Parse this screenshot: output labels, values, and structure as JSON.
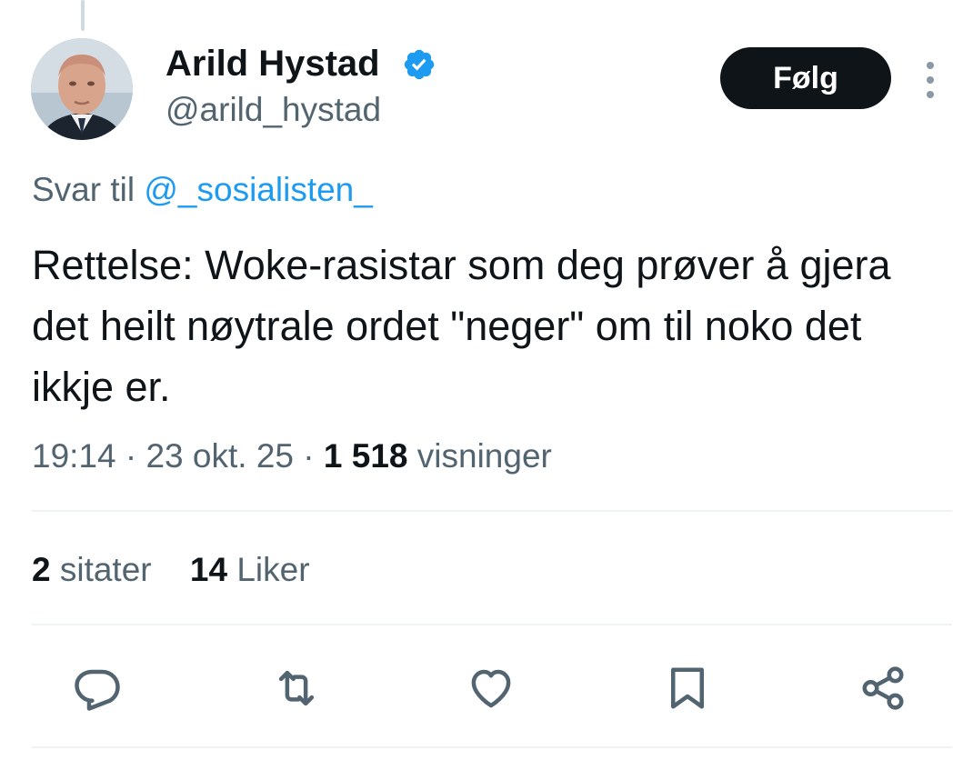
{
  "author": {
    "display_name": "Arild Hystad",
    "handle": "@arild_hystad",
    "verified": true,
    "verified_color": "#1d9bf0"
  },
  "follow_label": "Følg",
  "reply": {
    "prefix": "Svar til",
    "mention": "@_sosialisten_"
  },
  "tweet": {
    "text": "Rettelse: Woke-rasistar som deg prøver å gjera det heilt nøytrale ordet \"neger\" om til noko det ikkje er."
  },
  "meta": {
    "time": "19:14",
    "separator": " · ",
    "date": "23 okt. 25",
    "views_count": "1 518",
    "views_label": "visninger"
  },
  "stats": {
    "quotes_count": "2",
    "quotes_label": "sitater",
    "likes_count": "14",
    "likes_label": "Liker"
  },
  "actions": {
    "icons": [
      "reply-icon",
      "retweet-icon",
      "like-icon",
      "bookmark-icon",
      "share-icon"
    ]
  },
  "colors": {
    "text_primary": "#0f1419",
    "text_secondary": "#536471",
    "link": "#1d9bf0",
    "divider": "#eff3f4",
    "follow_bg": "#0f1419"
  }
}
